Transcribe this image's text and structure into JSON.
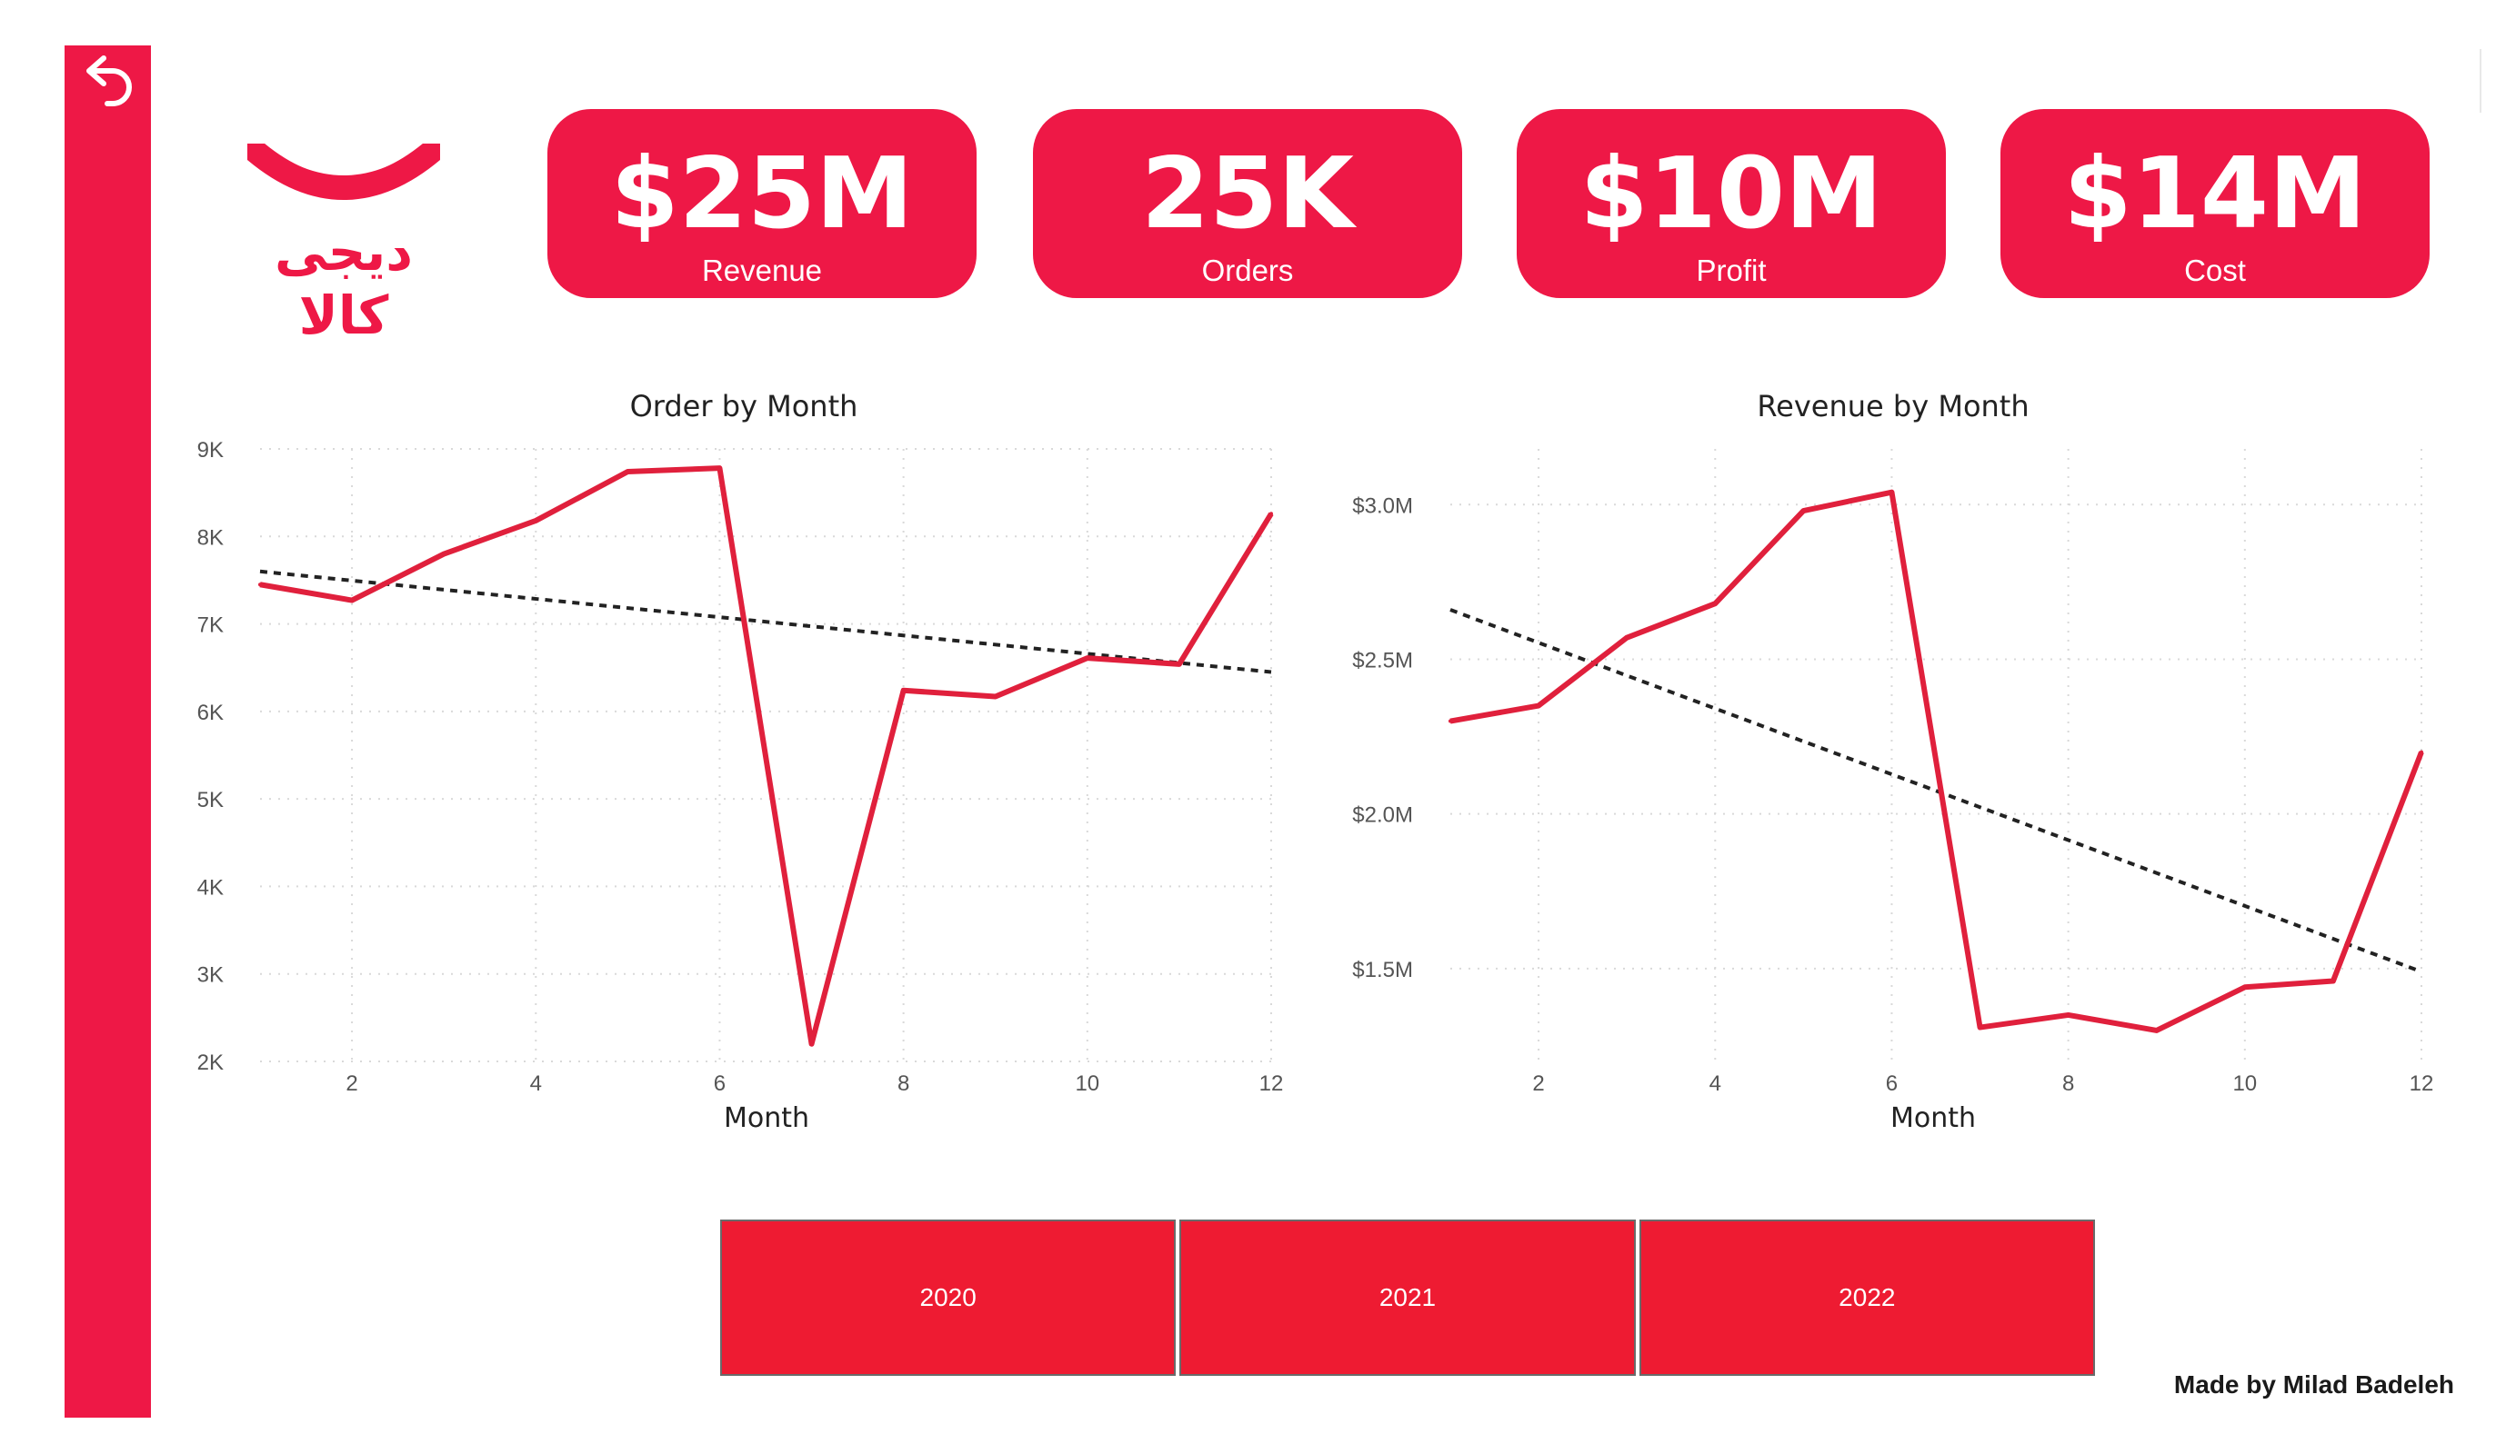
{
  "nav": {
    "back_icon": "undo-arrow-icon"
  },
  "brand": {
    "logo_text": "دیجی کالا",
    "color": "#EE1846"
  },
  "kpis": [
    {
      "value": "$25M",
      "label": "Revenue"
    },
    {
      "value": "25K",
      "label": "Orders"
    },
    {
      "value": "$10M",
      "label": "Profit"
    },
    {
      "value": "$14M",
      "label": "Cost"
    }
  ],
  "chart_data": [
    {
      "type": "line",
      "title": "Order by Month",
      "xlabel": "Month",
      "ylabel": "",
      "x": [
        1,
        2,
        3,
        4,
        5,
        6,
        7,
        8,
        9,
        10,
        11,
        12
      ],
      "series": [
        {
          "values": [
            7450,
            7270,
            7800,
            8180,
            8740,
            8780,
            2200,
            6240,
            6170,
            6610,
            6540,
            8260
          ],
          "color": "#E0203C"
        }
      ],
      "trendline": {
        "values_at": [
          1,
          12
        ],
        "y": [
          7600,
          6450
        ],
        "style": "dotted",
        "color": "#222222"
      },
      "xticks": [
        2,
        4,
        6,
        8,
        10,
        12
      ],
      "yticks": [
        2000,
        3000,
        4000,
        5000,
        6000,
        7000,
        8000,
        9000
      ],
      "ytick_labels": [
        "2K",
        "3K",
        "4K",
        "5K",
        "6K",
        "7K",
        "8K",
        "9K"
      ],
      "xlim": [
        1,
        12
      ],
      "ylim": [
        2000,
        9000
      ],
      "grid": true
    },
    {
      "type": "line",
      "title": "Revenue by Month",
      "xlabel": "Month",
      "ylabel": "",
      "x": [
        1,
        2,
        3,
        4,
        5,
        6,
        7,
        8,
        9,
        10,
        11,
        12
      ],
      "series": [
        {
          "values": [
            2300000,
            2350000,
            2570000,
            2680000,
            2980000,
            3040000,
            1310000,
            1350000,
            1300000,
            1440000,
            1460000,
            2200000
          ],
          "color": "#E0203C"
        }
      ],
      "trendline": {
        "values_at": [
          1,
          12
        ],
        "y": [
          2660000,
          1490000
        ],
        "style": "dotted",
        "color": "#222222"
      },
      "xticks": [
        2,
        4,
        6,
        8,
        10,
        12
      ],
      "yticks": [
        1500000,
        2000000,
        2500000,
        3000000
      ],
      "ytick_labels": [
        "$1.5M",
        "$2.0M",
        "$2.5M",
        "$3.0M"
      ],
      "xlim": [
        1,
        12
      ],
      "ylim": [
        1200000,
        3180000
      ],
      "grid": true
    }
  ],
  "year_slicer": [
    "2020",
    "2021",
    "2022"
  ],
  "footer": {
    "credit": "Made by Milad Badeleh"
  }
}
